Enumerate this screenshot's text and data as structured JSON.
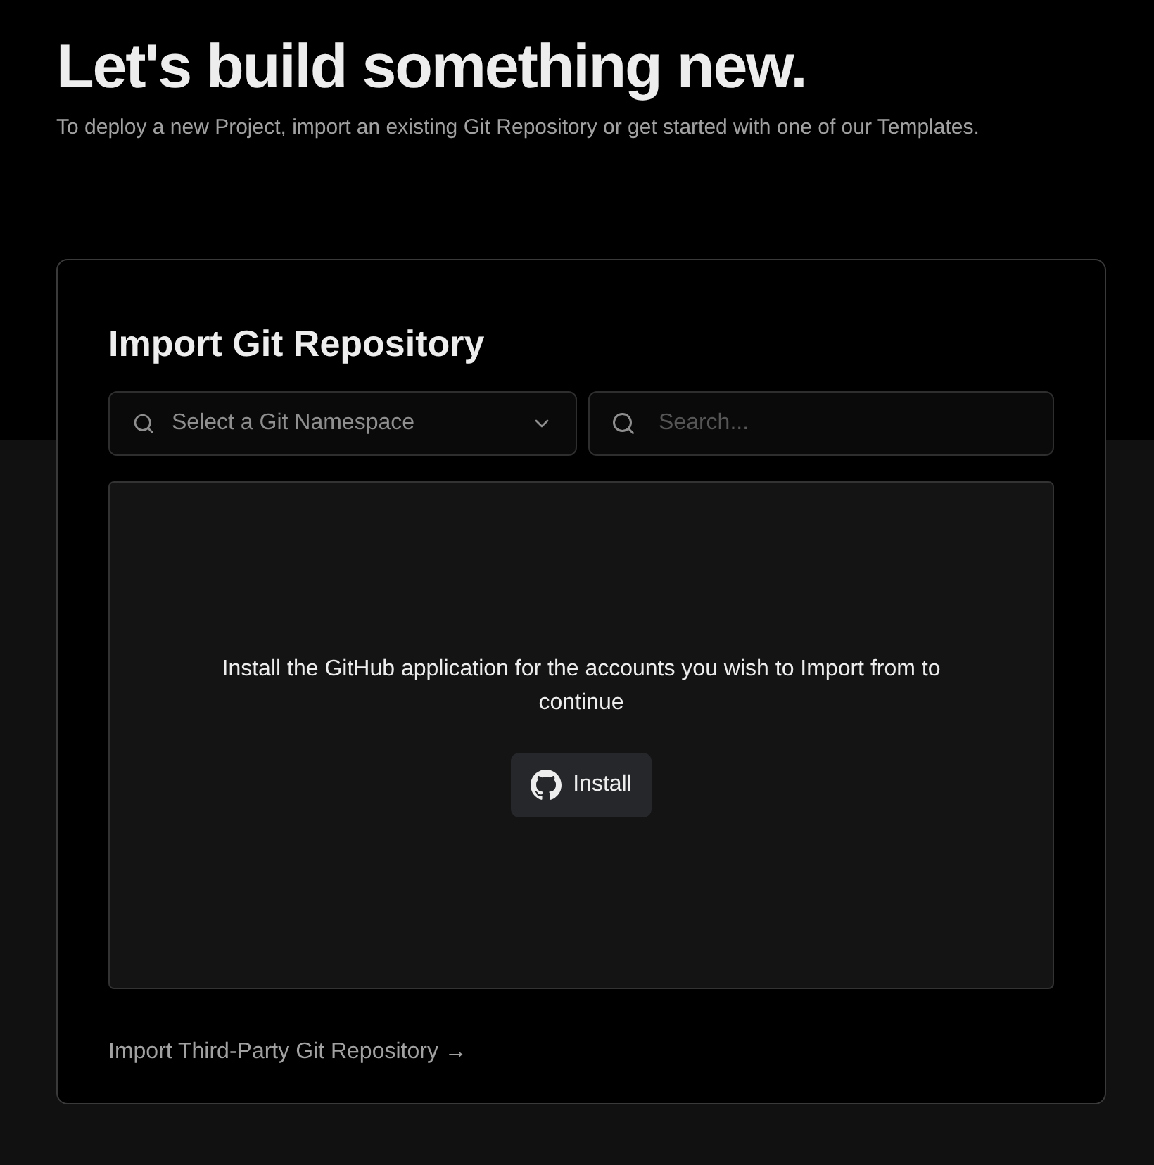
{
  "header": {
    "title": "Let's build something new.",
    "subtitle": "To deploy a new Project, import an existing Git Repository or get started with one of our Templates."
  },
  "import_card": {
    "title": "Import Git Repository",
    "namespace_select": {
      "placeholder": "Select a Git Namespace"
    },
    "search": {
      "placeholder": "Search..."
    },
    "message": "Install the GitHub application for the accounts you wish to Import from to continue",
    "install_button": "Install",
    "third_party_link": "Import Third-Party Git Repository →"
  }
}
